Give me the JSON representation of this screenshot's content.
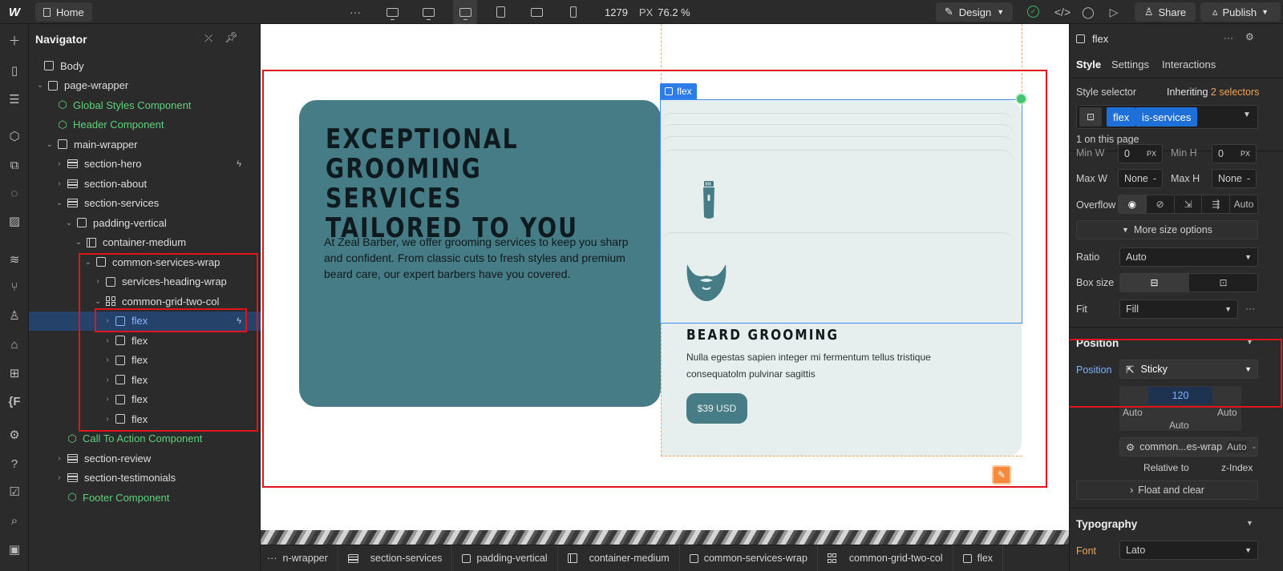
{
  "topbar": {
    "logo": "W",
    "home_tab": "Home",
    "more": "···",
    "viewport_width": "1279",
    "unit": "PX",
    "zoom": "76.2 %",
    "design_label": "Design",
    "share_label": "Share",
    "publish_label": "Publish"
  },
  "navigator": {
    "title": "Navigator",
    "tree": [
      {
        "label": "Body"
      },
      {
        "label": "page-wrapper"
      },
      {
        "label": "Global Styles Component"
      },
      {
        "label": "Header Component"
      },
      {
        "label": "main-wrapper"
      },
      {
        "label": "section-hero"
      },
      {
        "label": "section-about"
      },
      {
        "label": "section-services"
      },
      {
        "label": "padding-vertical"
      },
      {
        "label": "container-medium"
      },
      {
        "label": "common-services-wrap"
      },
      {
        "label": "services-heading-wrap"
      },
      {
        "label": "common-grid-two-col"
      },
      {
        "label": "flex"
      },
      {
        "label": "flex"
      },
      {
        "label": "flex"
      },
      {
        "label": "flex"
      },
      {
        "label": "flex"
      },
      {
        "label": "flex"
      },
      {
        "label": "Call To Action Component"
      },
      {
        "label": "section-review"
      },
      {
        "label": "section-testimonials"
      },
      {
        "label": "Footer Component"
      }
    ]
  },
  "canvas": {
    "heading_lines": [
      "EXCEPTIONAL",
      "GROOMING SERVICES",
      "TAILORED TO YOU"
    ],
    "paragraph": "At Zeal Barber, we offer grooming services to keep you sharp and confident. From classic cuts to fresh styles and premium beard care, our expert barbers have you covered.",
    "selected_tag": "flex",
    "card_title": "BEARD GROOMING",
    "card_desc": "Nulla egestas sapien integer mi fermentum tellus tristique consequatolm pulvinar sagittis",
    "price": "$39 USD"
  },
  "breadcrumbs": [
    "n-wrapper",
    "section-services",
    "padding-vertical",
    "container-medium",
    "common-services-wrap",
    "common-grid-two-col",
    "flex"
  ],
  "right_panel": {
    "element_name": "flex",
    "tabs": [
      "Style",
      "Settings",
      "Interactions"
    ],
    "style_selector_label": "Style selector",
    "inheriting_label": "Inheriting",
    "inheriting_count": "2 selectors",
    "selectors": [
      "flex",
      "is-services"
    ],
    "on_page": "1 on this page",
    "min_w_label": "Min W",
    "min_h_label": "Min H",
    "min_w_value": "0",
    "min_h_value": "0",
    "max_w_label": "Max W",
    "max_w_value": "None",
    "max_h_label": "Max H",
    "max_h_value": "None",
    "overflow_label": "Overflow",
    "overflow_auto": "Auto",
    "more_size": "More size options",
    "ratio_label": "Ratio",
    "ratio_value": "Auto",
    "box_size_label": "Box size",
    "fit_label": "Fit",
    "fit_value": "Fill",
    "position_heading": "Position",
    "position_label": "Position",
    "position_value": "Sticky",
    "pos_top": "120",
    "pos_left": "Auto",
    "pos_right": "Auto",
    "pos_bottom": "Auto",
    "relative_to_value": "common...es-wrap",
    "z_index_value": "Auto",
    "relative_to_label": "Relative to",
    "z_index_label": "z-Index",
    "float_clear": "Float and clear",
    "typography_heading": "Typography",
    "font_label": "Font",
    "font_value": "Lato"
  },
  "colors": {
    "teal": "#467c86",
    "panel_light": "#e6eeee",
    "selection_blue": "#2e7ce8",
    "annotation_red": "#e0141c",
    "component_green": "#5fd17a"
  }
}
